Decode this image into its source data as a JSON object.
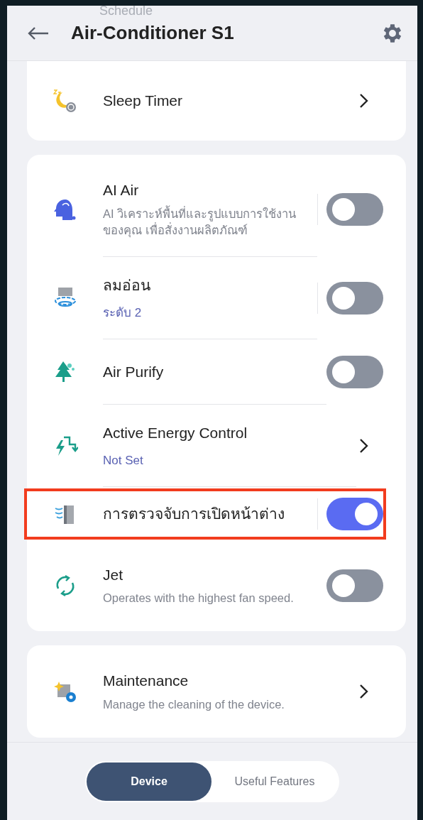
{
  "header": {
    "behind_text": "Schedule",
    "title": "Air-Conditioner S1"
  },
  "cards": [
    {
      "items": [
        {
          "kind": "link",
          "title": "Sleep Timer",
          "divider": false,
          "highlighted": false
        }
      ]
    },
    {
      "items": [
        {
          "kind": "toggle",
          "title": "AI Air",
          "description": "AI วิเคราะห์พื้นที่และรูปแบบการใช้งานของคุณ เพื่อสั่งงานผลิตภัณฑ์",
          "on": false,
          "divider": true,
          "highlighted": false
        },
        {
          "kind": "toggle",
          "title": "ลมอ่อน",
          "value": "ระดับ 2",
          "on": false,
          "divider": true,
          "highlighted": false
        },
        {
          "kind": "toggle",
          "title": "Air Purify",
          "on": false,
          "divider": false,
          "highlighted": false
        },
        {
          "kind": "link",
          "title": "Active Energy Control",
          "value": "Not Set",
          "divider": false,
          "highlighted": false
        },
        {
          "kind": "toggle",
          "title": "การตรวจจับการเปิดหน้าต่าง",
          "on": true,
          "divider": true,
          "highlighted": true
        },
        {
          "kind": "toggle",
          "title": "Jet",
          "description": "Operates with the highest fan speed.",
          "on": false,
          "divider": false,
          "highlighted": false
        }
      ]
    },
    {
      "items": [
        {
          "kind": "link",
          "title": "Maintenance",
          "description": "Manage the cleaning of the device.",
          "divider": false,
          "highlighted": false
        }
      ]
    }
  ],
  "tabs": [
    {
      "label": "Device",
      "selected": true
    },
    {
      "label": "Useful Features",
      "selected": false
    }
  ]
}
